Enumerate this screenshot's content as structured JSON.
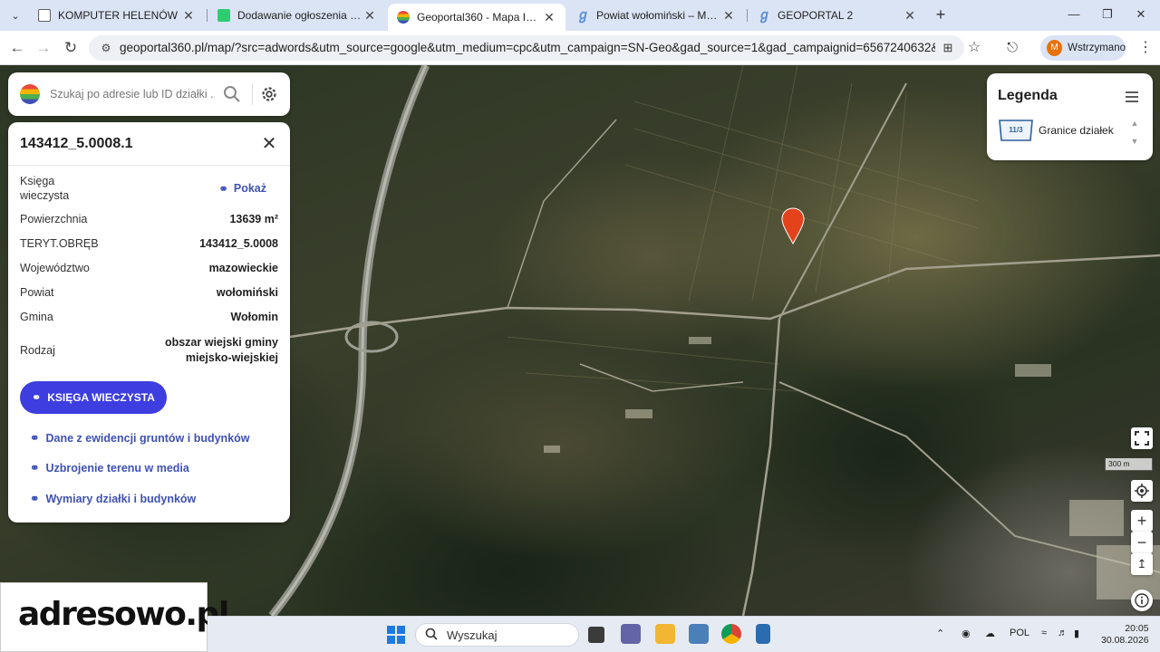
{
  "browser": {
    "tabs": [
      {
        "title": "KOMPUTER HELENÓW",
        "favicon": "page-icon",
        "active": false
      },
      {
        "title": "Dodawanie ogłoszenia | Otodom",
        "favicon": "otodom-icon",
        "active": false
      },
      {
        "title": "Geoportal360 - Mapa Interaktywna",
        "favicon": "geoportal360-icon",
        "active": true
      },
      {
        "title": "Powiat wołomiński – Mapy - GEOPORTAL",
        "favicon": "geoportal-icon",
        "active": false
      },
      {
        "title": "GEOPORTAL 2",
        "favicon": "geoportal-icon",
        "active": false
      }
    ],
    "url": "geoportal360.pl/map/?src=adwords&utm_source=google&utm_medium=cpc&utm_campaign=SN-Geo&gad_source=1&gad_campaignid=6567240632&gbraid=0AAAAAC",
    "profile": {
      "initial": "M",
      "status": "Wstrzymano"
    }
  },
  "search": {
    "placeholder": "Szukaj po adresie lub ID działki ..."
  },
  "parcel": {
    "id": "143412_5.0008.1",
    "kw_label": "Księga wieczysta",
    "kw_action": "Pokaż",
    "rows": [
      {
        "label": "Powierzchnia",
        "value": "13639 m²"
      },
      {
        "label": "TERYT.OBRĘB",
        "value": "143412_5.0008"
      },
      {
        "label": "Województwo",
        "value": "mazowieckie"
      },
      {
        "label": "Powiat",
        "value": "wołomiński"
      },
      {
        "label": "Gmina",
        "value": "Wołomin"
      },
      {
        "label": "Rodzaj",
        "value": "obszar wiejski gminy miejsko-wiejskiej"
      }
    ],
    "kw_button": "KSIĘGA WIECZYSTA",
    "links": [
      "Dane z ewidencji gruntów i budynków",
      "Uzbrojenie terenu w media",
      "Wymiary działki i budynków"
    ]
  },
  "legend": {
    "title": "Legenda",
    "items": [
      {
        "symbol_label": "11/3",
        "label": "Granice działek"
      }
    ]
  },
  "map": {
    "scale": "300 m",
    "marker_color": "#e3421b"
  },
  "watermark": "adresowo.pl",
  "taskbar": {
    "search_label": "Wyszukaj",
    "language": "POL",
    "time": "20:05",
    "date": "30.08.2026"
  },
  "colors": {
    "accent": "#3d3de0",
    "link": "#3f51b5"
  }
}
